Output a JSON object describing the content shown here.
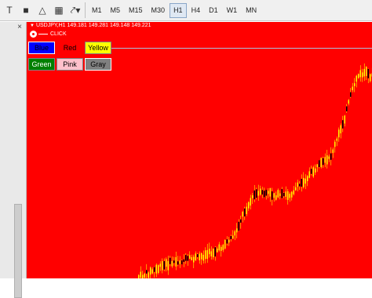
{
  "toolbar": {
    "icons": [
      "text-tool-icon",
      "rectangle-tool-icon",
      "triangle-tool-icon",
      "label-tool-icon",
      "arrow-tool-icon"
    ],
    "timeframes": [
      "M1",
      "M5",
      "M15",
      "M30",
      "H1",
      "H4",
      "D1",
      "W1",
      "MN"
    ],
    "active_timeframe": "H1"
  },
  "chart": {
    "title": "USDJPY,H1  149.181 149.281 149.148 149.221",
    "script_label": "CLICK",
    "background": "#ff0000",
    "candle_color": "#ffff00",
    "wick_color": "#ffff00",
    "buttons": [
      {
        "label": "Blue",
        "color": "#0000ff"
      },
      {
        "label": "Red",
        "color": "#ff0000"
      },
      {
        "label": "Yellow",
        "color": "#ffff00"
      },
      {
        "label": "Green",
        "color": "#008000"
      },
      {
        "label": "Pink",
        "color": "#ffc0cb"
      },
      {
        "label": "Gray",
        "color": "#808080"
      }
    ]
  }
}
